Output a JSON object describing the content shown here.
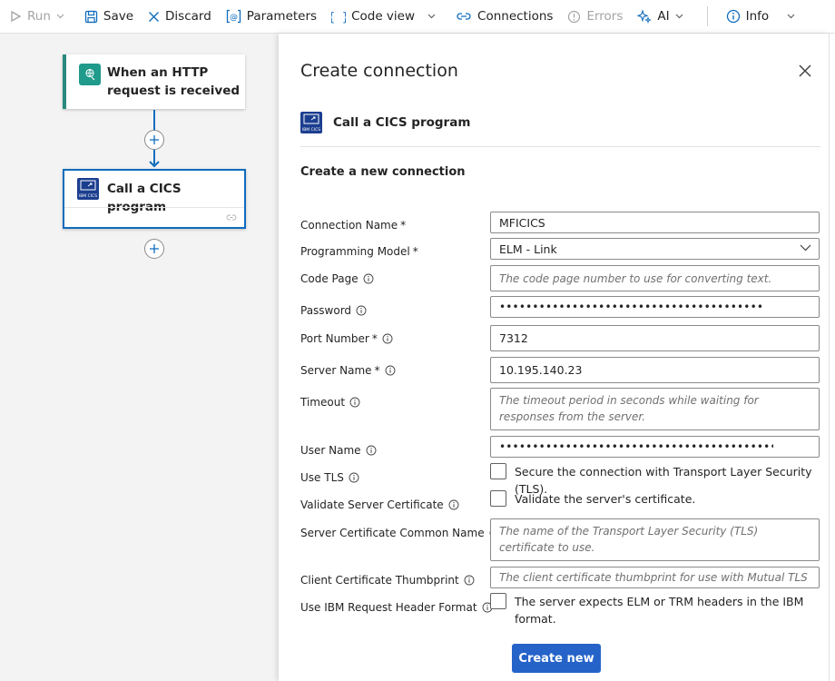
{
  "toolbar": {
    "run": "Run",
    "save": "Save",
    "discard": "Discard",
    "parameters": "Parameters",
    "code_view": "Code view",
    "connections": "Connections",
    "errors": "Errors",
    "ai": "AI",
    "info": "Info"
  },
  "canvas": {
    "trigger_title_line1": "When an HTTP",
    "trigger_title_line2": "request is received",
    "action_title": "Call a CICS program",
    "action_icon_text": "IBM CICS"
  },
  "panel": {
    "title": "Create connection",
    "connector_name": "Call a CICS program",
    "connector_icon_text": "IBM CICS",
    "section_title": "Create a new connection",
    "fields": {
      "connection_name": {
        "label": "Connection Name",
        "required": "*",
        "value": "MFICICS"
      },
      "programming_model": {
        "label": "Programming Model",
        "required": "*",
        "value": "ELM - Link"
      },
      "code_page": {
        "label": "Code Page",
        "placeholder": "The code page number to use for converting text."
      },
      "password": {
        "label": "Password",
        "value": "•••••••••••••••••••••••••••••••••••••••••••••••••••••"
      },
      "port_number": {
        "label": "Port Number",
        "required": "*",
        "value": "7312"
      },
      "server_name": {
        "label": "Server Name",
        "required": "*",
        "value": "10.195.140.23"
      },
      "timeout": {
        "label": "Timeout",
        "placeholder": "The timeout period in seconds while waiting for responses from the server."
      },
      "user_name": {
        "label": "User Name",
        "value": "•••••••••••••••••••••••••••••••••••••••••••••••••••••••"
      },
      "use_tls": {
        "label": "Use TLS",
        "checkbox_text": "Secure the connection with Transport Layer Security (TLS)."
      },
      "validate_cert": {
        "label": "Validate Server Certificate",
        "checkbox_text": "Validate the server's certificate."
      },
      "cert_common_name": {
        "label": "Server Certificate Common Name",
        "placeholder": "The name of the Transport Layer Security (TLS) certificate to use."
      },
      "client_thumbprint": {
        "label": "Client Certificate Thumbprint",
        "placeholder": "The client certificate thumbprint for use with Mutual TLS a..."
      },
      "ibm_header": {
        "label": "Use IBM Request Header Format",
        "checkbox_text": "The server expects ELM or TRM headers in the IBM format."
      }
    },
    "create_button": "Create new"
  },
  "colors": {
    "accent": "#0f6cbd",
    "primary_button": "#2563c9",
    "trigger_accent": "#1f9a8b",
    "cics_icon_bg": "#1b3e8f"
  }
}
